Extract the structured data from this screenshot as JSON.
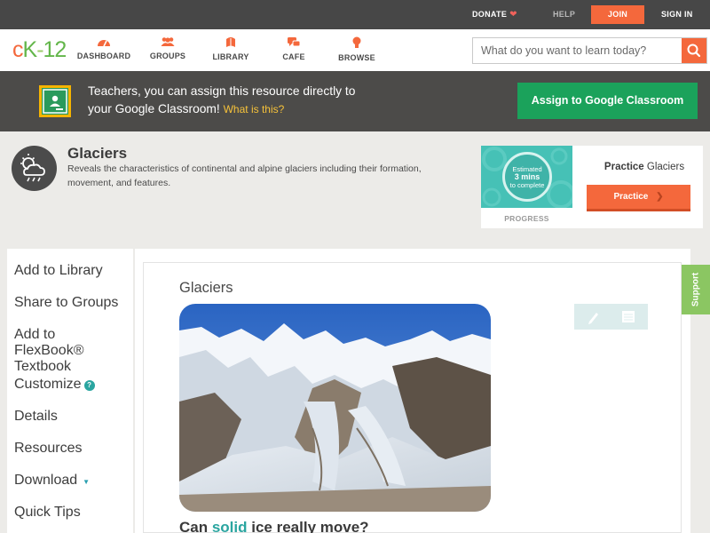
{
  "topbar": {
    "donate": "DONATE",
    "help": "HELP",
    "join": "JOIN",
    "signin": "SIGN IN"
  },
  "logo": {
    "c": "c",
    "k": "K",
    "dash": "-",
    "num": "12"
  },
  "nav": {
    "items": [
      {
        "label": "DASHBOARD",
        "icon": "dashboard-icon"
      },
      {
        "label": "GROUPS",
        "icon": "groups-icon"
      },
      {
        "label": "LIBRARY",
        "icon": "library-icon"
      },
      {
        "label": "CAFE",
        "icon": "cafe-icon"
      },
      {
        "label": "BROWSE",
        "icon": "browse-icon"
      }
    ],
    "search_placeholder": "What do you want to learn today?"
  },
  "banner": {
    "line1": "Teachers, you can assign this resource directly to",
    "line2": "your Google Classroom!",
    "what": "What is this?",
    "assign": "Assign to Google Classroom"
  },
  "concept": {
    "title": "Glaciers",
    "description": "Reveals the characteristics of continental and alpine glaciers including their formation, movement, and features."
  },
  "practice": {
    "estimated": "Estimated",
    "mins": "3 mins",
    "complete": "to complete",
    "progress_label": "PROGRESS",
    "title_bold": "Practice",
    "title_rest": "Glaciers",
    "button": "Practice"
  },
  "sidebar": {
    "items": [
      "Add to Library",
      "Share to Groups",
      "Add to FlexBook®",
      "Textbook",
      "Customize",
      "Details",
      "Resources",
      "Download",
      "Quick Tips"
    ]
  },
  "content": {
    "title": "Glaciers",
    "question_pre": "Can ",
    "question_hl": "solid",
    "question_post": " ice really move?",
    "support": "Support"
  },
  "colors": {
    "accent": "#f4683c",
    "green": "#1ba25b",
    "teal": "#2a9fb0",
    "support": "#8bc662"
  }
}
